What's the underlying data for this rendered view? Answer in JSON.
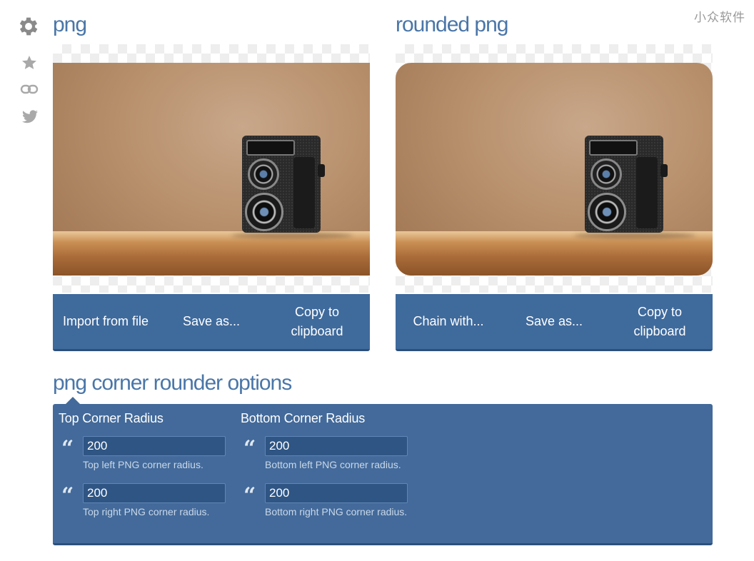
{
  "watermark": "小众软件",
  "sidebar": {
    "icons": [
      "gear-icon",
      "star-icon",
      "link-icon",
      "twitter-icon"
    ]
  },
  "left_panel": {
    "title": "png",
    "buttons": [
      "Import from file",
      "Save as...",
      "Copy to clipboard"
    ]
  },
  "right_panel": {
    "title": "rounded png",
    "buttons": [
      "Chain with...",
      "Save as...",
      "Copy to clipboard"
    ]
  },
  "options": {
    "title": "png corner rounder options",
    "top": {
      "heading": "Top Corner Radius",
      "left_value": "200",
      "left_help": "Top left PNG corner radius.",
      "right_value": "200",
      "right_help": "Top right PNG corner radius."
    },
    "bottom": {
      "heading": "Bottom Corner Radius",
      "left_value": "200",
      "left_help": "Bottom left PNG corner radius.",
      "right_value": "200",
      "right_help": "Bottom right PNG corner radius."
    }
  },
  "colors": {
    "accent": "#4a76a8",
    "panel": "#436a9a",
    "button_bar": "#3f6a9c"
  }
}
